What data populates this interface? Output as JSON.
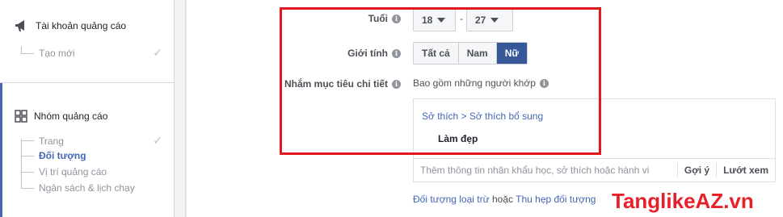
{
  "sidebar": {
    "ad_account": {
      "title": "Tài khoản quảng cáo",
      "items": [
        {
          "label": "Tạo mới",
          "done": true
        }
      ]
    },
    "ad_set": {
      "title": "Nhóm quảng cáo",
      "items": [
        {
          "label": "Trang",
          "done": true
        },
        {
          "label": "Đối tượng",
          "active": true
        },
        {
          "label": "Vị trí quảng cáo"
        },
        {
          "label": "Ngân sách & lịch chạy"
        }
      ]
    }
  },
  "form": {
    "age": {
      "label": "Tuổi",
      "min": "18",
      "separator": "-",
      "max": "27"
    },
    "gender": {
      "label": "Giới tính",
      "options": [
        "Tất cả",
        "Nam",
        "Nữ"
      ],
      "selected": "Nữ"
    },
    "detailed_targeting": {
      "label": "Nhắm mục tiêu chi tiết",
      "include_text": "Bao gồm những người khớp",
      "breadcrumb": "Sở thích > Sở thích bổ sung",
      "selected_interest": "Làm đẹp",
      "search_placeholder": "Thêm thông tin nhân khẩu học, sở thích hoặc hành vi",
      "suggest_label": "Gợi ý",
      "browse_label": "Lướt xem"
    },
    "exclude_link": "Đối tượng loại trừ",
    "or_text": "hoặc",
    "narrow_link": "Thu hẹp đối tượng"
  },
  "watermark": "TanglikeAZ.vn",
  "colors": {
    "accent": "#4267b2",
    "selected_segment": "#365899",
    "highlight_box": "#e0191f",
    "watermark": "#e8202a"
  },
  "icons": {
    "ad_account": "megaphone-icon",
    "ad_set": "grid-icon",
    "done": "checkmark-icon",
    "info": "info-icon",
    "dropdown": "caret-down-icon"
  }
}
